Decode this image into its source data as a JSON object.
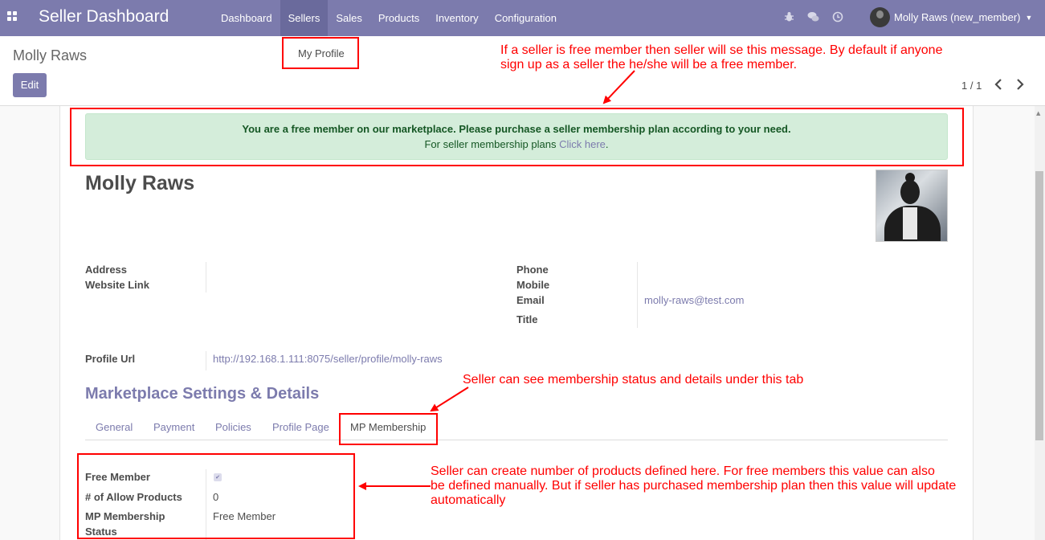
{
  "navbar": {
    "brand": "Seller Dashboard",
    "menu": [
      "Dashboard",
      "Sellers",
      "Sales",
      "Products",
      "Inventory",
      "Configuration"
    ],
    "active_menu": "Sellers",
    "user_name": "Molly Raws (new_member)",
    "icons": [
      "apps-icon",
      "bug-icon",
      "chat-icon",
      "clock-icon"
    ]
  },
  "dropdown": {
    "item": "My Profile"
  },
  "control_panel": {
    "breadcrumb": "Molly Raws",
    "edit_label": "Edit",
    "pager": "1 / 1"
  },
  "alert": {
    "line1": "You are a free member on our marketplace. Please purchase a seller membership plan according to your need.",
    "line2_prefix": "For seller membership plans ",
    "link": "Click here",
    "line2_suffix": "."
  },
  "profile": {
    "name": "Molly Raws",
    "address_label": "Address",
    "website_label": "Website Link",
    "phone_label": "Phone",
    "mobile_label": "Mobile",
    "email_label": "Email",
    "email": "molly-raws@test.com",
    "title_label": "Title",
    "profile_url_label": "Profile Url",
    "profile_url": "http://192.168.1.111:8075/seller/profile/molly-raws"
  },
  "settings": {
    "title": "Marketplace Settings & Details",
    "tabs": [
      "General",
      "Payment",
      "Policies",
      "Profile Page",
      "MP Membership"
    ],
    "active_tab": "MP Membership",
    "free_member_label": "Free Member",
    "free_member_checked": true,
    "allow_products_label": "# of Allow Products",
    "allow_products_value": "0",
    "membership_status_label_1": "MP Membership",
    "membership_status_label_2": "Status",
    "membership_status_value": "Free Member"
  },
  "annotations": {
    "note1_line1": "If a seller is free member then seller will se this message. By default if anyone",
    "note1_line2": "sign up as a seller the he/she will be a free member.",
    "note2": "Seller can see membership status and details under this tab",
    "note3_line1": "Seller can create number of products defined here. For free members this value can also",
    "note3_line2": "be defined manually. But if seller has purchased membership plan then this value will update",
    "note3_line3": "automatically",
    "color": "#ff0000"
  },
  "colors": {
    "navbar": "#7c7bad",
    "accent": "#7c7bad",
    "alert_bg": "#d4edda"
  }
}
